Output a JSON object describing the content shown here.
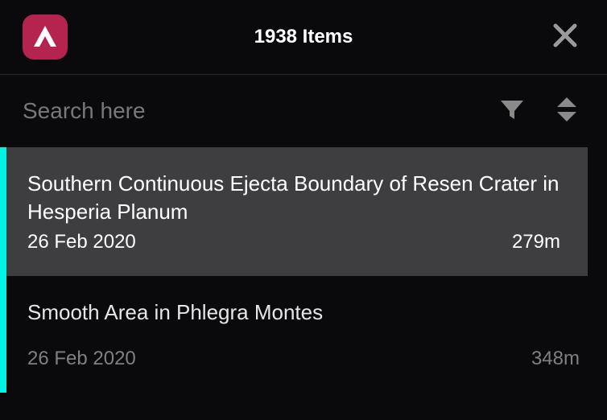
{
  "header": {
    "title": "1938 Items"
  },
  "search": {
    "placeholder": "Search here",
    "value": ""
  },
  "colors": {
    "accent": "#00f2e3",
    "logo_bg": "#b5244f"
  },
  "items": [
    {
      "title": "Southern Continuous Ejecta Boundary of Resen Crater in Hesperia Planum",
      "date": "26 Feb 2020",
      "value": "279m",
      "selected": true
    },
    {
      "title": "Smooth Area in Phlegra Montes",
      "date": "26 Feb 2020",
      "value": "348m",
      "selected": false
    }
  ]
}
